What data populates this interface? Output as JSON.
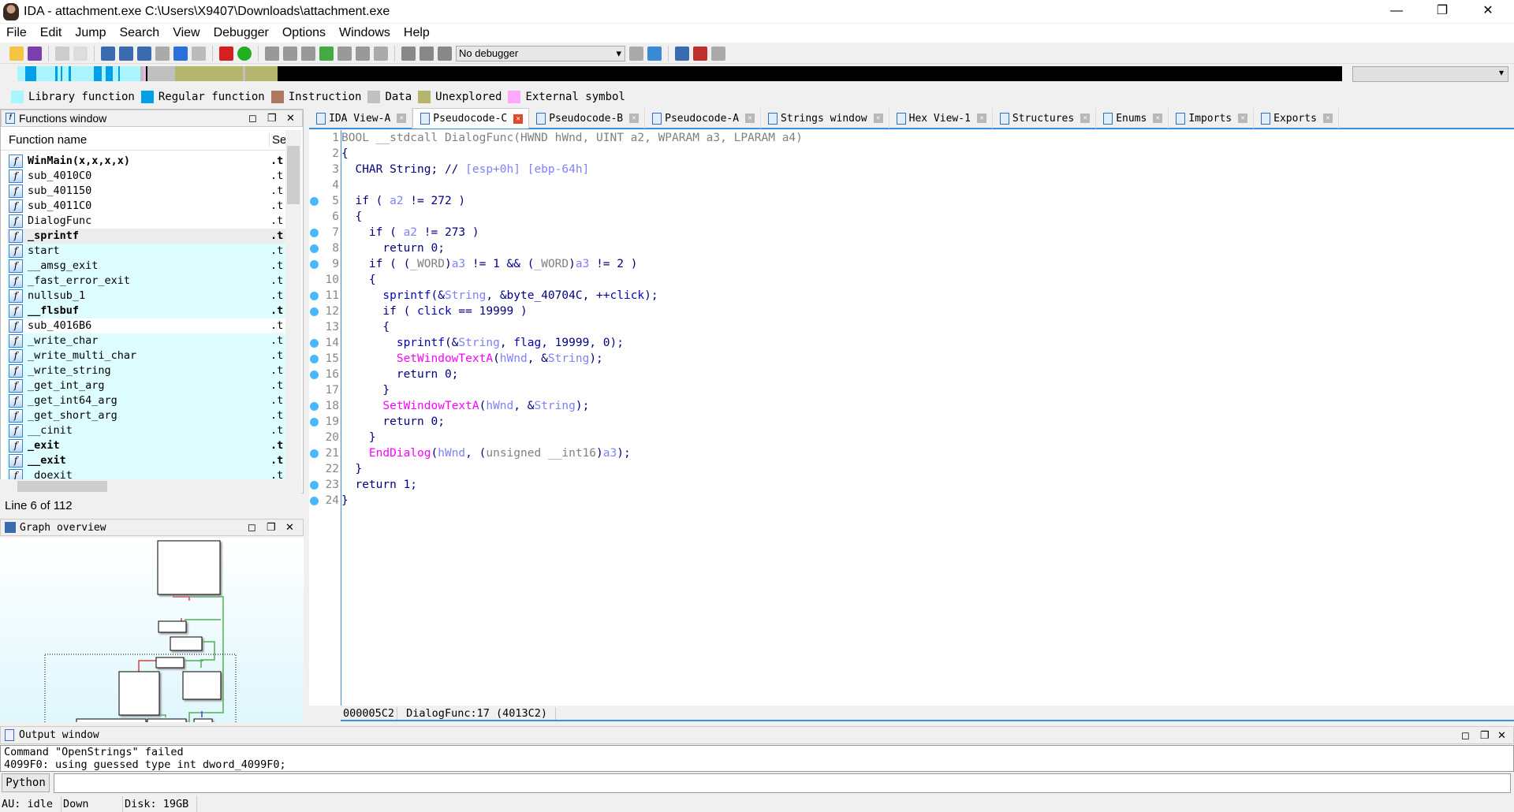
{
  "window": {
    "title": "IDA - attachment.exe C:\\Users\\X9407\\Downloads\\attachment.exe"
  },
  "menu": [
    "File",
    "Edit",
    "Jump",
    "Search",
    "View",
    "Debugger",
    "Options",
    "Windows",
    "Help"
  ],
  "toolbar": {
    "debugger_select": "No debugger"
  },
  "legend": [
    {
      "label": "Library function",
      "color": "#aaf5ff"
    },
    {
      "label": "Regular function",
      "color": "#00a0e8"
    },
    {
      "label": "Instruction",
      "color": "#b07860"
    },
    {
      "label": "Data",
      "color": "#c0c0c0"
    },
    {
      "label": "Unexplored",
      "color": "#b5b56e"
    },
    {
      "label": "External symbol",
      "color": "#ffa8ff"
    }
  ],
  "functions_window": {
    "title": "Functions window",
    "columns": [
      "Function name",
      "Se"
    ],
    "rows": [
      {
        "name": "WinMain(x,x,x,x)",
        "seg": ".t",
        "bold": true,
        "lib": false
      },
      {
        "name": "sub_4010C0",
        "seg": ".t",
        "bold": false,
        "lib": false
      },
      {
        "name": "sub_401150",
        "seg": ".t",
        "bold": false,
        "lib": false
      },
      {
        "name": "sub_4011C0",
        "seg": ".t",
        "bold": false,
        "lib": false
      },
      {
        "name": "DialogFunc",
        "seg": ".t",
        "bold": false,
        "lib": false
      },
      {
        "name": "_sprintf",
        "seg": ".t",
        "bold": true,
        "lib": true,
        "selected": true
      },
      {
        "name": "start",
        "seg": ".t",
        "bold": false,
        "lib": true
      },
      {
        "name": "__amsg_exit",
        "seg": ".t",
        "bold": false,
        "lib": true
      },
      {
        "name": "_fast_error_exit",
        "seg": ".t",
        "bold": false,
        "lib": true
      },
      {
        "name": "nullsub_1",
        "seg": ".t",
        "bold": false,
        "lib": true
      },
      {
        "name": "__flsbuf",
        "seg": ".t",
        "bold": true,
        "lib": true
      },
      {
        "name": "sub_4016B6",
        "seg": ".t",
        "bold": false,
        "lib": false
      },
      {
        "name": "_write_char",
        "seg": ".t",
        "bold": false,
        "lib": true
      },
      {
        "name": "_write_multi_char",
        "seg": ".t",
        "bold": false,
        "lib": true
      },
      {
        "name": "_write_string",
        "seg": ".t",
        "bold": false,
        "lib": true
      },
      {
        "name": "_get_int_arg",
        "seg": ".t",
        "bold": false,
        "lib": true
      },
      {
        "name": "_get_int64_arg",
        "seg": ".t",
        "bold": false,
        "lib": true
      },
      {
        "name": "_get_short_arg",
        "seg": ".t",
        "bold": false,
        "lib": true
      },
      {
        "name": "__cinit",
        "seg": ".t",
        "bold": false,
        "lib": true
      },
      {
        "name": "_exit",
        "seg": ".t",
        "bold": true,
        "lib": true
      },
      {
        "name": "__exit",
        "seg": ".t",
        "bold": true,
        "lib": true
      },
      {
        "name": "_doexit",
        "seg": ".t",
        "bold": false,
        "lib": true
      }
    ],
    "line_info": "Line 6 of 112"
  },
  "graph_overview": {
    "title": "Graph overview"
  },
  "tabs": [
    {
      "label": "IDA View-A",
      "active": false
    },
    {
      "label": "Pseudocode-C",
      "active": true
    },
    {
      "label": "Pseudocode-B",
      "active": false
    },
    {
      "label": "Pseudocode-A",
      "active": false
    },
    {
      "label": "Strings window",
      "active": false
    },
    {
      "label": "Hex View-1",
      "active": false
    },
    {
      "label": "Structures",
      "active": false
    },
    {
      "label": "Enums",
      "active": false
    },
    {
      "label": "Imports",
      "active": false
    },
    {
      "label": "Exports",
      "active": false
    }
  ],
  "code": [
    {
      "n": "1",
      "bp": false,
      "t": [
        [
          "BOOL __stdcall DialogFunc(HWND hWnd, UINT a2, WPARAM a3, LPARAM a4)",
          "g"
        ]
      ]
    },
    {
      "n": "2",
      "bp": false,
      "t": [
        [
          "{",
          "k"
        ]
      ]
    },
    {
      "n": "3",
      "bp": false,
      "t": [
        [
          "  CHAR String; // ",
          "k"
        ],
        [
          "[esp+0h] [ebp-64h]",
          "v"
        ]
      ]
    },
    {
      "n": "4",
      "bp": false,
      "t": []
    },
    {
      "n": "5",
      "bp": true,
      "t": [
        [
          "  if ( ",
          "k"
        ],
        [
          "a2",
          "v"
        ],
        [
          " != 272 )",
          "k"
        ]
      ]
    },
    {
      "n": "6",
      "bp": false,
      "t": [
        [
          "  {",
          "k"
        ]
      ]
    },
    {
      "n": "7",
      "bp": true,
      "t": [
        [
          "    if ( ",
          "k"
        ],
        [
          "a2",
          "v"
        ],
        [
          " != 273 )",
          "k"
        ]
      ]
    },
    {
      "n": "8",
      "bp": true,
      "t": [
        [
          "      return 0;",
          "k"
        ]
      ]
    },
    {
      "n": "9",
      "bp": true,
      "t": [
        [
          "    if ( (",
          "k"
        ],
        [
          "_WORD",
          "g"
        ],
        [
          ")",
          "k"
        ],
        [
          "a3",
          "v"
        ],
        [
          " != 1 && (",
          "k"
        ],
        [
          "_WORD",
          "g"
        ],
        [
          ")",
          "k"
        ],
        [
          "a3",
          "v"
        ],
        [
          " != 2 )",
          "k"
        ]
      ]
    },
    {
      "n": "10",
      "bp": false,
      "t": [
        [
          "    {",
          "k"
        ]
      ]
    },
    {
      "n": "11",
      "bp": true,
      "t": [
        [
          "      ",
          "k"
        ],
        [
          "sprintf",
          "c"
        ],
        [
          "(&",
          "k"
        ],
        [
          "String",
          "v"
        ],
        [
          ", &byte_40704C, ++",
          "k"
        ],
        [
          "click",
          "c"
        ],
        [
          ");",
          "k"
        ]
      ]
    },
    {
      "n": "12",
      "bp": true,
      "t": [
        [
          "      if ( ",
          "k"
        ],
        [
          "click",
          "c"
        ],
        [
          " == 19999 )",
          "k"
        ]
      ]
    },
    {
      "n": "13",
      "bp": false,
      "t": [
        [
          "      {",
          "k"
        ]
      ]
    },
    {
      "n": "14",
      "bp": true,
      "t": [
        [
          "        ",
          "k"
        ],
        [
          "sprintf",
          "c"
        ],
        [
          "(&",
          "k"
        ],
        [
          "String",
          "v"
        ],
        [
          ", ",
          "k"
        ],
        [
          "flag",
          "c"
        ],
        [
          ", 19999, 0);",
          "k"
        ]
      ]
    },
    {
      "n": "15",
      "bp": true,
      "t": [
        [
          "        ",
          "k"
        ],
        [
          "SetWindowTextA",
          "f"
        ],
        [
          "(",
          "k"
        ],
        [
          "hWnd",
          "v"
        ],
        [
          ", &",
          "k"
        ],
        [
          "String",
          "v"
        ],
        [
          ");",
          "k"
        ]
      ]
    },
    {
      "n": "16",
      "bp": true,
      "t": [
        [
          "        return 0;",
          "k"
        ]
      ]
    },
    {
      "n": "17",
      "bp": false,
      "t": [
        [
          "      }",
          "k"
        ]
      ]
    },
    {
      "n": "18",
      "bp": true,
      "t": [
        [
          "      ",
          "k"
        ],
        [
          "SetWindowTextA",
          "f"
        ],
        [
          "(",
          "k"
        ],
        [
          "hWnd",
          "v"
        ],
        [
          ", &",
          "k"
        ],
        [
          "String",
          "v"
        ],
        [
          ");",
          "k"
        ]
      ]
    },
    {
      "n": "19",
      "bp": true,
      "t": [
        [
          "      return 0;",
          "k"
        ]
      ]
    },
    {
      "n": "20",
      "bp": false,
      "t": [
        [
          "    }",
          "k"
        ]
      ]
    },
    {
      "n": "21",
      "bp": true,
      "t": [
        [
          "    ",
          "k"
        ],
        [
          "EndDialog",
          "f"
        ],
        [
          "(",
          "k"
        ],
        [
          "hWnd",
          "v"
        ],
        [
          ", (",
          "k"
        ],
        [
          "unsigned __int16",
          "g"
        ],
        [
          ")",
          "k"
        ],
        [
          "a3",
          "v"
        ],
        [
          ");",
          "k"
        ]
      ]
    },
    {
      "n": "22",
      "bp": false,
      "t": [
        [
          "  }",
          "k"
        ]
      ]
    },
    {
      "n": "23",
      "bp": true,
      "t": [
        [
          "  return 1;",
          "k"
        ]
      ]
    },
    {
      "n": "24",
      "bp": true,
      "t": [
        [
          "}",
          "k"
        ]
      ]
    }
  ],
  "code_status": {
    "offset": "000005C2",
    "location": "DialogFunc:17 (4013C2)"
  },
  "output_window": {
    "title": "Output window",
    "lines": [
      "Command \"OpenStrings\" failed",
      "4099F0: using guessed type int dword_4099F0;"
    ]
  },
  "python": {
    "label": "Python",
    "value": ""
  },
  "statusbar": {
    "au": "AU:  idle",
    "direction": "Down",
    "disk": "Disk: 19GB"
  }
}
